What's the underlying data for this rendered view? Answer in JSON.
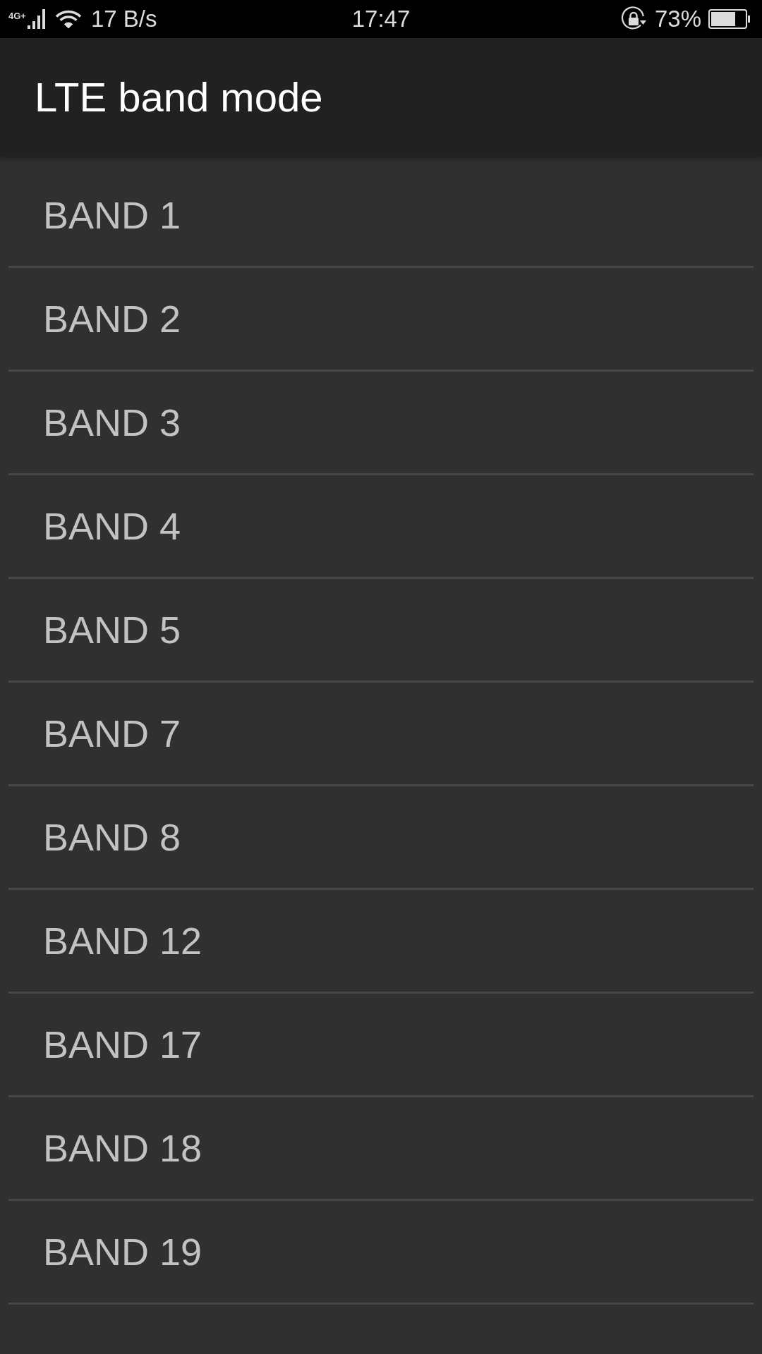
{
  "status_bar": {
    "network_type": "4G+",
    "data_rate": "17 B/s",
    "time": "17:47",
    "battery_percent": "73%"
  },
  "app_bar": {
    "title": "LTE band mode"
  },
  "bands": [
    "BAND 1",
    "BAND 2",
    "BAND 3",
    "BAND 4",
    "BAND 5",
    "BAND 7",
    "BAND 8",
    "BAND 12",
    "BAND 17",
    "BAND 18",
    "BAND 19"
  ]
}
